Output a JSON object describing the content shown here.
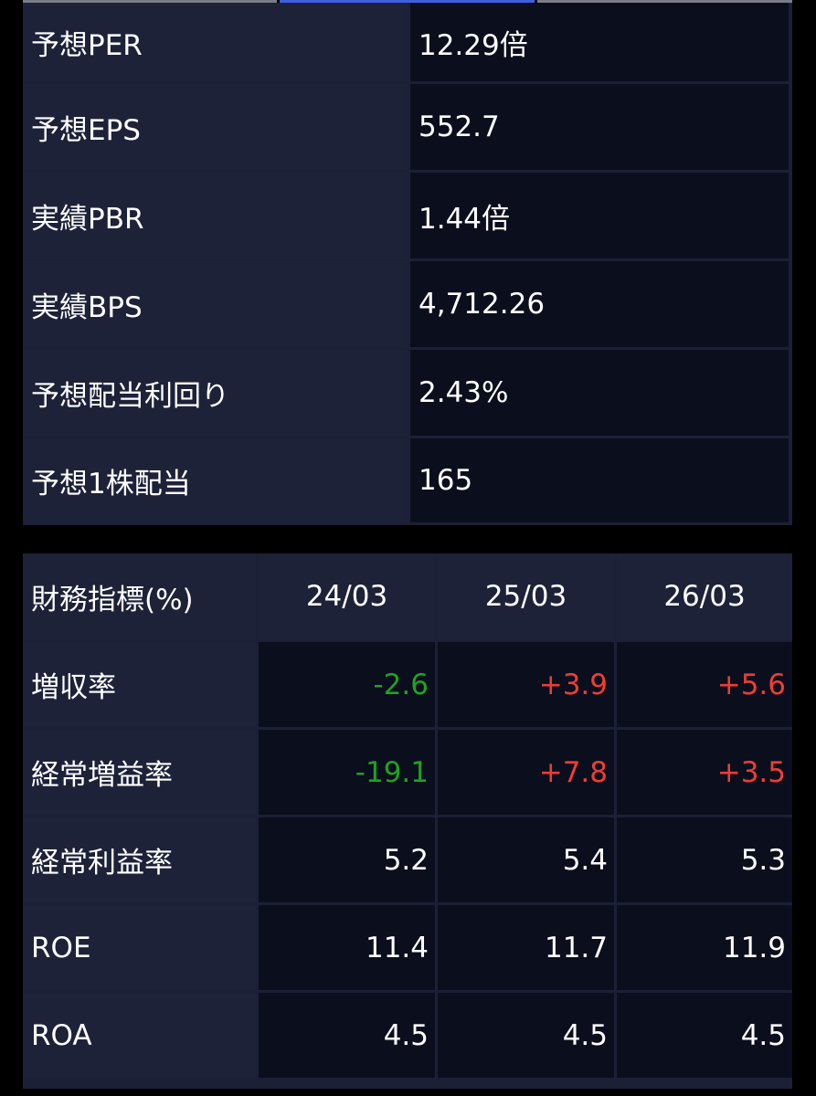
{
  "colors": {
    "negative": "#1fa31f",
    "positive": "#ef3d33",
    "label_bg": "#1d2239",
    "value_bg": "#0b0e1d",
    "tab_active": "#3f5fe0"
  },
  "valuation": {
    "rows": [
      {
        "label": "予想PER",
        "value": "12.29倍"
      },
      {
        "label": "予想EPS",
        "value": "552.7"
      },
      {
        "label": "実績PBR",
        "value": "1.44倍"
      },
      {
        "label": "実績BPS",
        "value": "4,712.26"
      },
      {
        "label": "予想配当利回り",
        "value": "2.43%"
      },
      {
        "label": "予想1株配当",
        "value": "165"
      }
    ]
  },
  "financials": {
    "header": [
      "財務指標(%)",
      "24/03",
      "25/03",
      "26/03"
    ],
    "rows": [
      {
        "label": "増収率",
        "values": [
          "-2.6",
          "+3.9",
          "+5.6"
        ]
      },
      {
        "label": "経常増益率",
        "values": [
          "-19.1",
          "+7.8",
          "+3.5"
        ]
      },
      {
        "label": "経常利益率",
        "values": [
          "5.2",
          "5.4",
          "5.3"
        ]
      },
      {
        "label": "ROE",
        "values": [
          "11.4",
          "11.7",
          "11.9"
        ]
      },
      {
        "label": "ROA",
        "values": [
          "4.5",
          "4.5",
          "4.5"
        ]
      }
    ]
  }
}
